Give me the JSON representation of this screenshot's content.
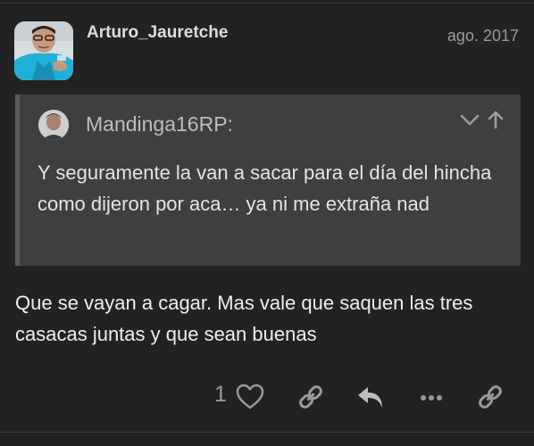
{
  "post": {
    "username": "Arturo_Jauretche",
    "date": "ago. 2017",
    "body": "Que se vayan a cagar. Mas vale que saquen las tres casacas juntas y que sean buenas",
    "like_count": "1"
  },
  "quote": {
    "author": "Mandinga16RP:",
    "text": "Y seguramente la van a sacar para el día del hincha como dijeron por aca… ya ni me extraña nad"
  },
  "colors": {
    "background": "#222222",
    "quote_background": "#3f3f3f",
    "icon": "#9a9a9a"
  },
  "icons": {
    "like": "heart-icon",
    "link": "link-icon",
    "reply": "reply-icon",
    "more": "ellipsis-icon",
    "share": "link-icon",
    "expand": "chevron-down-icon",
    "jump": "arrow-up-icon"
  }
}
